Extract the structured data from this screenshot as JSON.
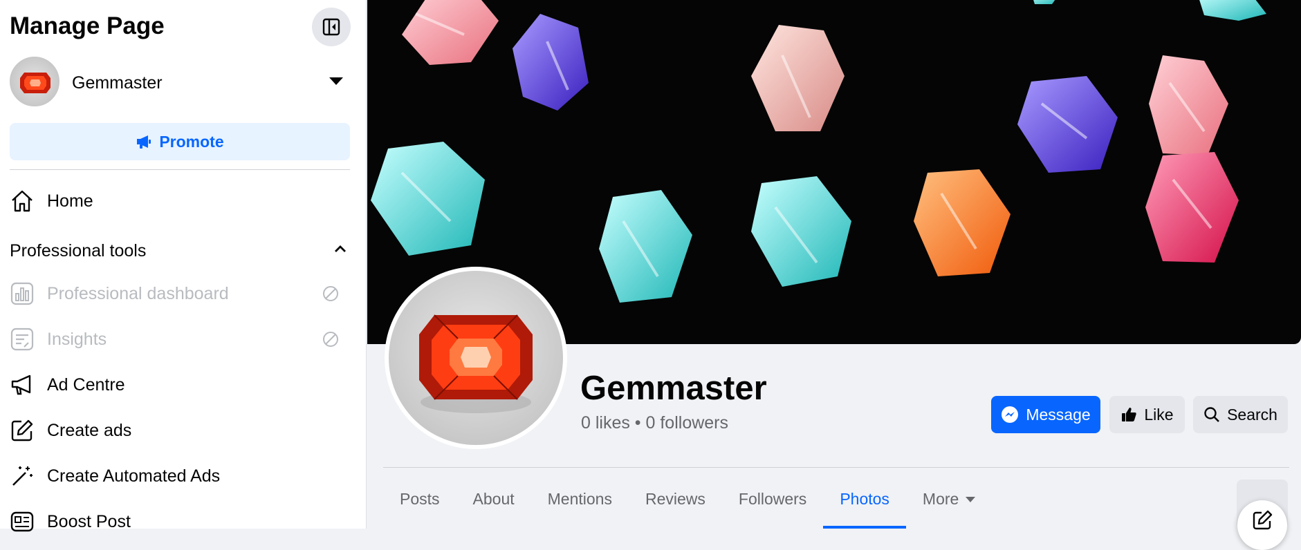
{
  "sidebar": {
    "title": "Manage Page",
    "page_name": "Gemmaster",
    "promote_label": "Promote",
    "home_label": "Home",
    "section_label": "Professional tools",
    "items": [
      {
        "label": "Professional dashboard",
        "disabled": true
      },
      {
        "label": "Insights",
        "disabled": true
      },
      {
        "label": "Ad Centre",
        "disabled": false
      },
      {
        "label": "Create ads",
        "disabled": false
      },
      {
        "label": "Create Automated Ads",
        "disabled": false
      },
      {
        "label": "Boost Post",
        "disabled": false
      }
    ]
  },
  "profile": {
    "name": "Gemmaster",
    "stats": "0 likes • 0 followers"
  },
  "actions": {
    "message_label": "Message",
    "like_label": "Like",
    "search_label": "Search"
  },
  "tabs": [
    {
      "label": "Posts",
      "active": false
    },
    {
      "label": "About",
      "active": false
    },
    {
      "label": "Mentions",
      "active": false
    },
    {
      "label": "Reviews",
      "active": false
    },
    {
      "label": "Followers",
      "active": false
    },
    {
      "label": "Photos",
      "active": true
    },
    {
      "label": "More",
      "active": false
    }
  ],
  "colors": {
    "accent": "#0866ff",
    "promote_bg": "#e7f3ff",
    "disabled_text": "#b8bbbf"
  }
}
